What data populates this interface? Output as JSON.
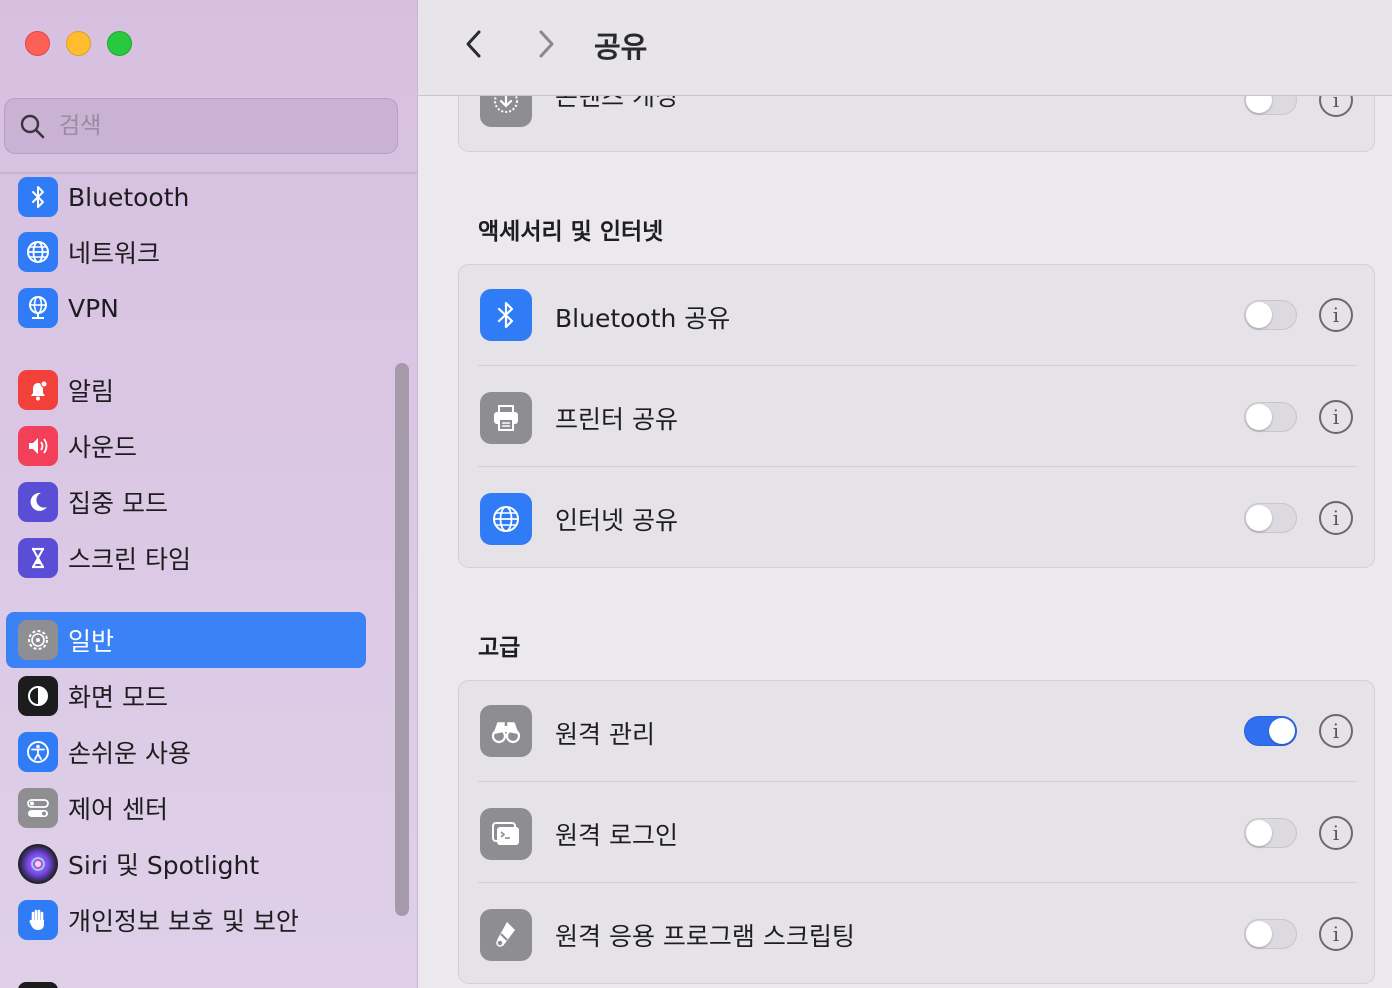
{
  "window": {
    "title": "공유"
  },
  "search": {
    "placeholder": "검색"
  },
  "sidebar": {
    "items": [
      {
        "label": "Bluetooth",
        "icon": "bluetooth-icon",
        "color": "#2f7cf6"
      },
      {
        "label": "네트워크",
        "icon": "globe-icon",
        "color": "#2f7cf6"
      },
      {
        "label": "VPN",
        "icon": "vpn-globe-icon",
        "color": "#2f7cf6"
      },
      {
        "label": "알림",
        "icon": "bell-icon",
        "color": "#f2403a"
      },
      {
        "label": "사운드",
        "icon": "speaker-icon",
        "color": "#f2405a"
      },
      {
        "label": "집중 모드",
        "icon": "moon-icon",
        "color": "#5b4ed6"
      },
      {
        "label": "스크린 타임",
        "icon": "hourglass-icon",
        "color": "#5b4ed6"
      },
      {
        "label": "일반",
        "icon": "gear-icon",
        "color": "#8e8e93",
        "selected": true
      },
      {
        "label": "화면 모드",
        "icon": "appearance-icon",
        "color": "#1c1c1e"
      },
      {
        "label": "손쉬운 사용",
        "icon": "accessibility-icon",
        "color": "#2f7cf6"
      },
      {
        "label": "제어 센터",
        "icon": "control-center-icon",
        "color": "#8e8e93"
      },
      {
        "label": "Siri 및 Spotlight",
        "icon": "siri-icon",
        "color": "#1c1c1e"
      },
      {
        "label": "개인정보 보호 및 보안",
        "icon": "hand-icon",
        "color": "#2f7cf6"
      }
    ]
  },
  "sections": {
    "top_partial": {
      "rows": [
        {
          "label": "콘텐츠 캐싱",
          "icon": "content-caching-icon",
          "enabled": false
        }
      ]
    },
    "accessories": {
      "title": "액세서리 및 인터넷",
      "rows": [
        {
          "label": "Bluetooth 공유",
          "icon": "bluetooth-icon",
          "enabled": false
        },
        {
          "label": "프린터 공유",
          "icon": "printer-icon",
          "enabled": false
        },
        {
          "label": "인터넷 공유",
          "icon": "globe-icon",
          "enabled": false
        }
      ]
    },
    "advanced": {
      "title": "고급",
      "rows": [
        {
          "label": "원격 관리",
          "icon": "binoculars-icon",
          "enabled": true
        },
        {
          "label": "원격 로그인",
          "icon": "terminal-icon",
          "enabled": false
        },
        {
          "label": "원격 응용 프로그램 스크립팅",
          "icon": "script-icon",
          "enabled": false
        }
      ]
    }
  },
  "info_glyph": "i",
  "colors": {
    "accent": "#2f6ff0",
    "selection": "#3b82f6"
  }
}
